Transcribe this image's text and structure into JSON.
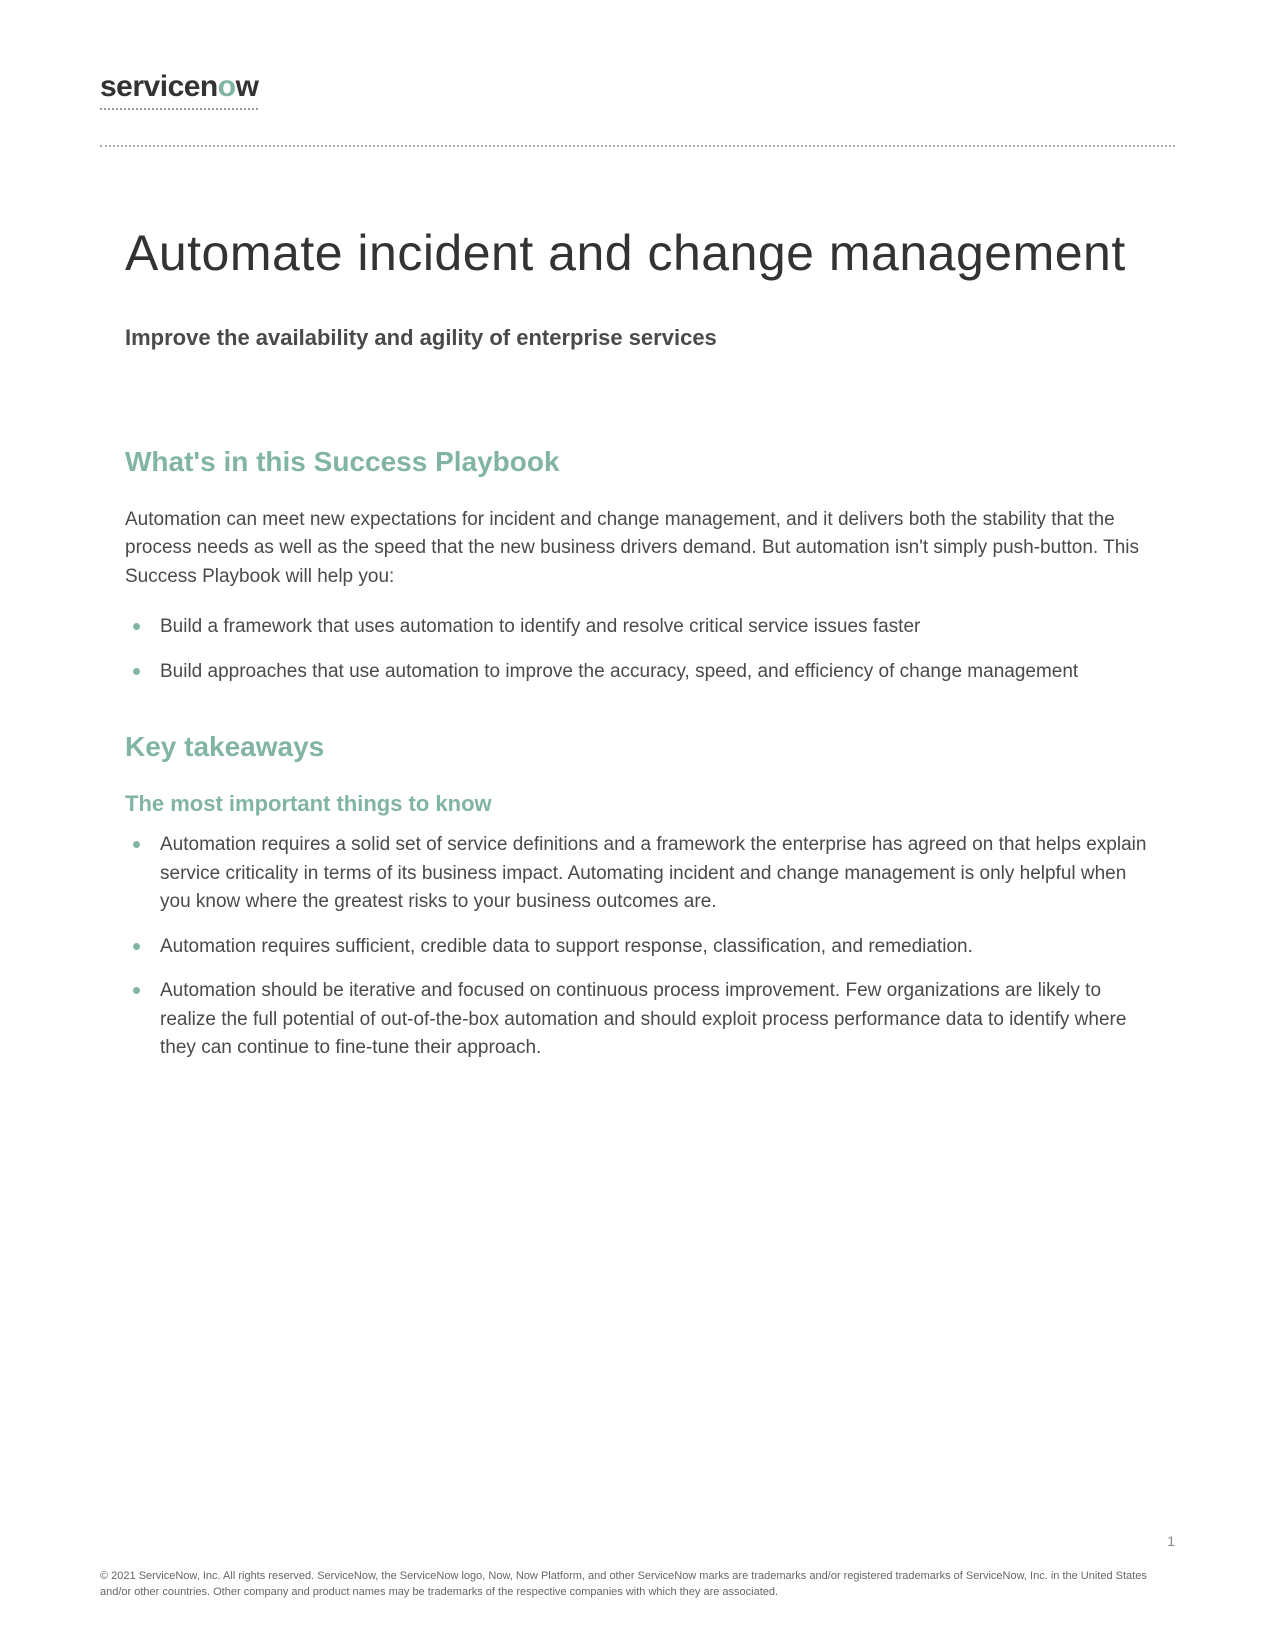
{
  "logo": {
    "prefix": "servicen",
    "o": "o",
    "suffix": "w"
  },
  "title": "Automate incident and change management",
  "subtitle": "Improve the availability and agility of enterprise services",
  "section1": {
    "heading": "What's in this Success Playbook",
    "intro": "Automation can meet new expectations for incident and change management, and it delivers both the stability that the process needs as well as the speed that the new business drivers demand. But automation isn't simply push-button. This Success Playbook will help you:",
    "bullets": [
      "Build a framework that uses automation to identify and resolve critical service issues faster",
      "Build approaches that use automation to improve the accuracy, speed, and efficiency of change management"
    ]
  },
  "section2": {
    "heading": "Key takeaways",
    "subheading": "The most important things to know",
    "bullets": [
      "Automation requires a solid set of service definitions and a framework the enterprise has agreed on that helps explain service criticality in terms of its business impact. Automating incident and change management is only helpful when you know where the greatest risks to your business outcomes are.",
      "Automation requires sufficient, credible data to support response, classification, and remediation.",
      "Automation should be iterative and focused on continuous process improvement. Few organizations are likely to realize the full potential of out-of-the-box automation and should exploit process performance data to identify where they can continue to fine-tune their approach."
    ]
  },
  "footer": {
    "pageNumber": "1",
    "copyright": "© 2021 ServiceNow, Inc. All rights reserved. ServiceNow, the ServiceNow logo, Now, Now Platform, and other ServiceNow marks are trademarks and/or registered trademarks of ServiceNow, Inc. in the United States and/or other countries. Other company and product names may be trademarks of the respective companies with which they are associated."
  }
}
